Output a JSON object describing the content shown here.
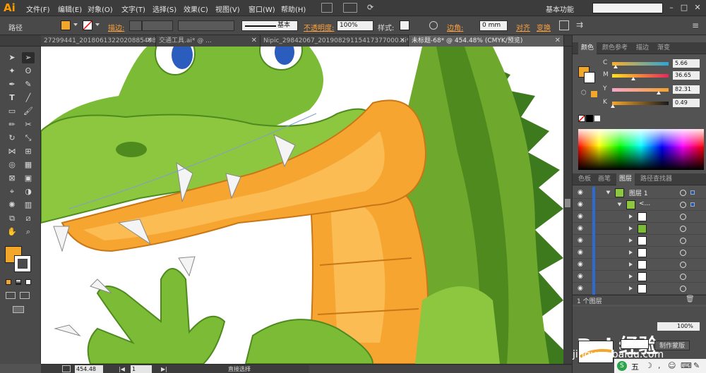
{
  "app": {
    "logo": "Ai",
    "workspace": "基本功能"
  },
  "menu": [
    "文件(F)",
    "编辑(E)",
    "对象(O)",
    "文字(T)",
    "选择(S)",
    "效果(C)",
    "视图(V)",
    "窗口(W)",
    "帮助(H)"
  ],
  "control": {
    "selection_type": "路径",
    "stroke_label": "描边:",
    "stroke_style": "基本",
    "opacity_label": "不透明度:",
    "opacity_value": "100%",
    "style_label": "样式:",
    "corner_label": "边角:",
    "corner_value": "0 mm",
    "align_label": "对齐",
    "transform_label": "变换"
  },
  "tabs": [
    {
      "label": "27299441_201806132202088540888.ai*"
    },
    {
      "label": "交通工具.ai* @ ..."
    },
    {
      "label": "Nipic_29842067_20190829115417377000.ai*"
    },
    {
      "label": "未标题-68* @ 454.48% (CMYK/预览)",
      "active": true
    }
  ],
  "color_panel": {
    "tabs": [
      "颜色",
      "颜色参考",
      "描边",
      "渐变"
    ],
    "channels": [
      {
        "name": "C",
        "value": "5.66",
        "pos": 0.06
      },
      {
        "name": "M",
        "value": "36.65",
        "pos": 0.37
      },
      {
        "name": "Y",
        "value": "82.31",
        "pos": 0.82
      },
      {
        "name": "K",
        "value": "0.49",
        "pos": 0.01
      }
    ],
    "fill_color": "#f2a62a"
  },
  "layers_panel": {
    "tabs": [
      "色板",
      "画笔",
      "图层",
      "路径查找器"
    ],
    "layer_name": "图层 1",
    "group_name": "<...",
    "footer": "1 个图层"
  },
  "status": {
    "zoom": "454.48",
    "page": "1",
    "tool": "直接选择"
  },
  "watermark": {
    "brand": "Bai 经验",
    "site": "jingyan.baidu.com"
  },
  "bottom_panel": {
    "button": "制作蒙版",
    "value": "100%"
  },
  "ime_text": "五"
}
